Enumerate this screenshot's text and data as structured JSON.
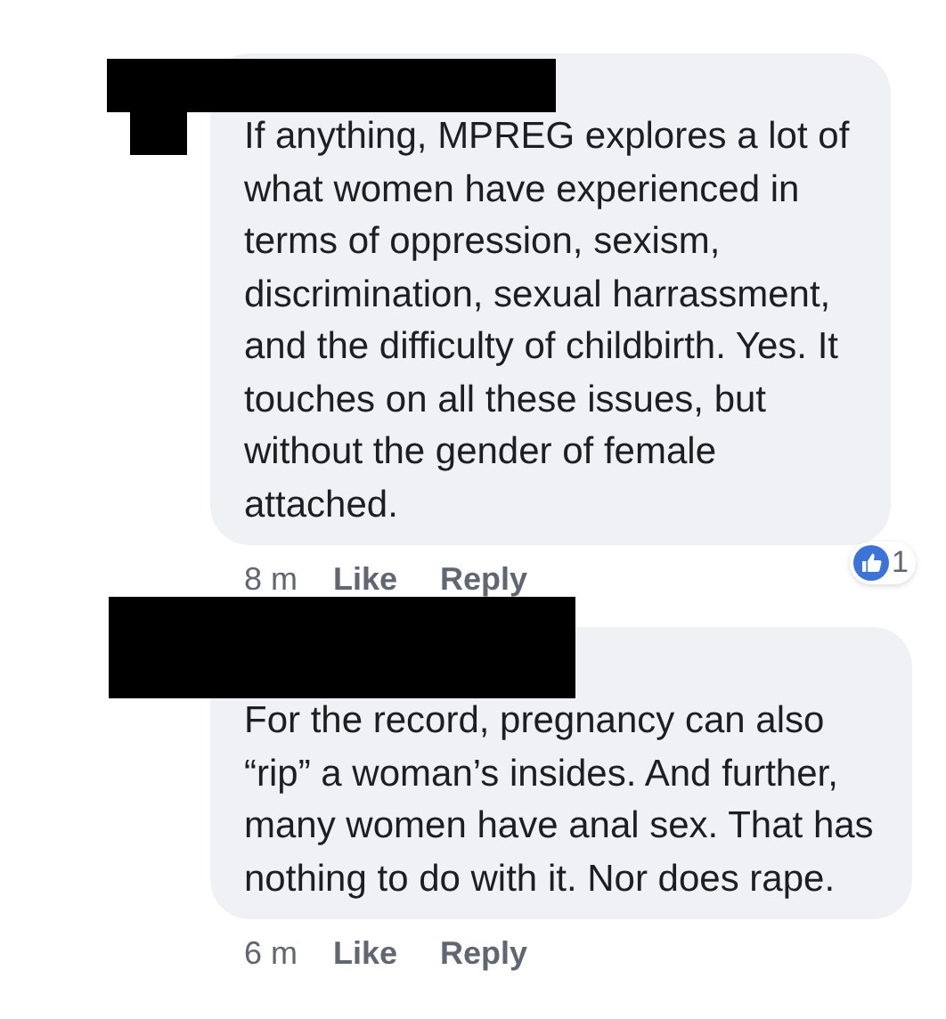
{
  "comments": [
    {
      "text": "If anything, MPREG explores a lot of what women have experienced in terms of oppression, sexism, discrimination, sexual harrassment, and the difficulty of childbirth. Yes. It touches on all these issues, but without the gender of female attached.",
      "time": "8 m",
      "actions": [
        "Like",
        "Reply"
      ],
      "reactions": {
        "count": "1"
      }
    },
    {
      "text": "For the record, pregnancy can also “rip” a woman’s insides. And further, many women have anal sex. That has nothing to do with it. Nor does rape.",
      "time": "6 m",
      "actions": [
        "Like",
        "Reply"
      ]
    }
  ]
}
